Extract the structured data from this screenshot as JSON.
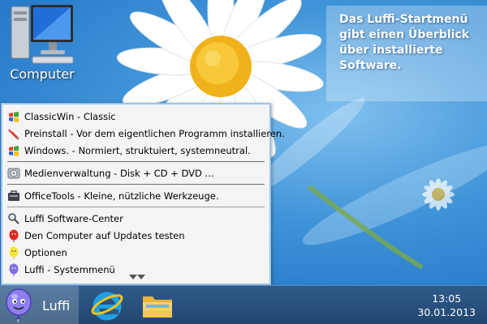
{
  "desktop": {
    "icon": {
      "label": "Computer",
      "icon": "computer-icon"
    },
    "callout": {
      "text": "Das Luffi-Startmenü\ngibt einen Überblick\nüber installierte\nSoftware."
    }
  },
  "menu": {
    "items": [
      {
        "label": "ClassicWin - Classic",
        "icon": "windows-flag-icon"
      },
      {
        "label": "Preinstall - Vor dem eigentlichen Programm installieren.",
        "icon": "wrench-icon"
      },
      {
        "label": "Windows. - Normiert, struktuiert, systemneutral.",
        "icon": "windows-flag-icon"
      },
      {
        "label": "Medienverwaltung - Disk + CD + DVD ...",
        "icon": "disc-icon"
      },
      {
        "label": "OfficeTools - Kleine, nützliche Werkzeuge.",
        "icon": "toolbox-icon"
      },
      {
        "label": "Luffi Software-Center",
        "icon": "magnifier-icon"
      },
      {
        "label": "Den Computer auf Updates testen",
        "icon": "red-balloon-icon"
      },
      {
        "label": "Optionen",
        "icon": "yellow-balloon-icon"
      },
      {
        "label": "Luffi - Systemmenü",
        "icon": "purple-balloon-icon"
      }
    ]
  },
  "taskbar": {
    "start_label": "Luffi",
    "clock_time": "13:05",
    "clock_date": "30.01.2013",
    "apps": [
      "internet-explorer-icon",
      "file-explorer-icon"
    ]
  }
}
